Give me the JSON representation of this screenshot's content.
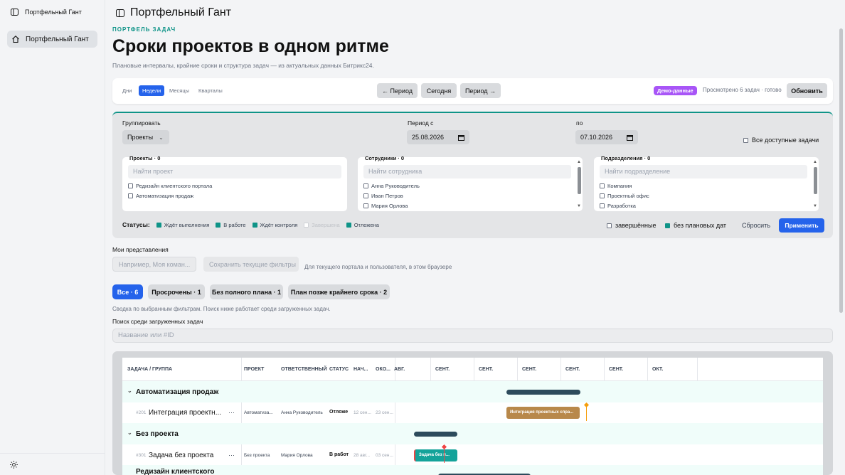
{
  "sidebar": {
    "app_title": "Портфельный Гант",
    "items": [
      {
        "label": "Портфельный Гант"
      }
    ]
  },
  "header": {
    "title": "Портфельный Гант",
    "eyebrow": "ПОРТФЕЛЬ ЗАДАЧ",
    "h1": "Сроки проектов в одном ритме",
    "subtitle": "Плановые интервалы, крайние сроки и структура задач — из актуальных данных Битрикс24."
  },
  "toolbar": {
    "scales": [
      "Дни",
      "Недели",
      "Месяцы",
      "Кварталы"
    ],
    "active_scale": "Недели",
    "prev": "← Период",
    "today": "Сегодня",
    "next": "Период →",
    "demo_badge": "Демо-данные",
    "viewed": "Просмотрено 6 задач · готово",
    "refresh": "Обновить"
  },
  "filters": {
    "group_label": "Группировать",
    "group_value": "Проекты",
    "period_from_label": "Период с",
    "period_from": "25.08.2026",
    "period_to_label": "по",
    "period_to": "07.10.2026",
    "all_tasks": "Все доступные задачи",
    "projects": {
      "title": "Проекты · 0",
      "placeholder": "Найти проект",
      "items": [
        "Редизайн клиентского портала",
        "Автоматизация продаж"
      ]
    },
    "employees": {
      "title": "Сотрудники · 0",
      "placeholder": "Найти сотрудника",
      "items": [
        "Анна Руководитель",
        "Иван Петров",
        "Мария Орлова"
      ]
    },
    "departments": {
      "title": "Подразделения · 0",
      "placeholder": "Найти подразделение",
      "items": [
        "Компания",
        "Проектный офис",
        "Разработка"
      ]
    },
    "statuses_label": "Статусы:",
    "statuses": [
      {
        "label": "Ждёт выполнения",
        "checked": true
      },
      {
        "label": "В работе",
        "checked": true
      },
      {
        "label": "Ждёт контроля",
        "checked": true
      },
      {
        "label": "Завершена",
        "checked": false
      },
      {
        "label": "Отложена",
        "checked": true
      }
    ],
    "completed": "завершённые",
    "no_dates": "без плановых дат",
    "reset": "Сбросить",
    "apply": "Применить"
  },
  "views": {
    "label": "Мои представления",
    "placeholder": "Например, Моя коман...",
    "save": "Сохранить текущие фильтры",
    "note": "Для текущего портала и пользователя, в этом браузере"
  },
  "chips": [
    "Все · 6",
    "Просрочены · 1",
    "Без полного плана · 1",
    "План позже крайнего срока · 2"
  ],
  "hint": "Сводка по выбранным фильтрам. Поиск ниже работает среди загруженных задач.",
  "search": {
    "label": "Поиск среди загруженных задач",
    "placeholder": "Название или #ID"
  },
  "gantt": {
    "columns": [
      "ЗАДАЧА / ГРУППА",
      "ПРОЕКТ",
      "ОТВЕТСТВЕННЫЙ",
      "СТАТУС",
      "НАЧ...",
      "ОКО..."
    ],
    "timeline": [
      "АВГ.",
      "СЕНТ.",
      "СЕНТ.",
      "СЕНТ.",
      "СЕНТ.",
      "СЕНТ.",
      "ОКТ."
    ],
    "groups": [
      {
        "name": "Автоматизация продаж",
        "task": {
          "id": "#201",
          "name": "Интеграция проектн...",
          "project": "Автоматиза...",
          "owner": "Анна Руководитель",
          "status": "Отложе",
          "start": "12 сен...",
          "end": "23 сен...",
          "bar_label": "Интеграция проектных спра..."
        }
      },
      {
        "name": "Без проекта",
        "task": {
          "id": "#301",
          "name": "Задача без проекта",
          "project": "Без проекта",
          "owner": "Мария Орлова",
          "status": "В работ",
          "start": "28 авг...",
          "end": "03 сен...",
          "bar_label": "Задача без п..."
        }
      },
      {
        "name": "Редизайн клиентского"
      }
    ],
    "more_icon": "···"
  },
  "colors": {
    "accent": "#2563eb",
    "teal": "#0f9488",
    "group_bar": "#2d4b5c",
    "task_orange": "#b8884a",
    "task_teal": "#14a39a",
    "deadline": "#f59e0b"
  }
}
